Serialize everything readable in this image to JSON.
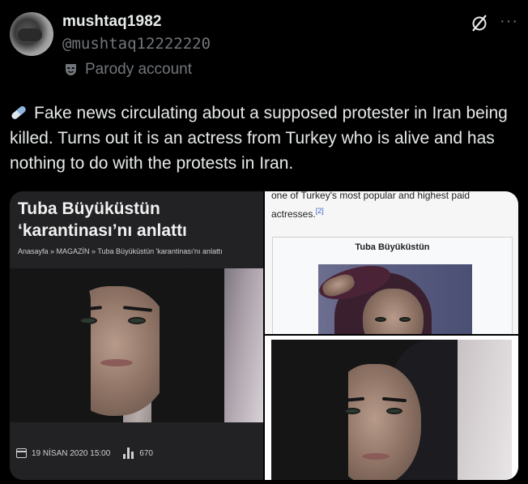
{
  "author": {
    "name": "mushtaq1982",
    "handle": "@mushtaq12222220",
    "label": "Parody account",
    "label_icon": "mask-icon"
  },
  "actions": {
    "grok_icon": "grok-icon",
    "more_icon": "more-icon",
    "more_glyph": "···"
  },
  "tweet": {
    "emoji": "pill-emoji",
    "text": "Fake news circulating about a supposed protester in Iran being killed. Turns out it is an actress from Turkey who is alive and has nothing to do with the protests in Iran."
  },
  "media": {
    "left": {
      "title": "Tuba Büyüküstün ‘karantinası’nı anlattı",
      "breadcrumb": "Anasayfa » MAGAZİN » Tuba Büyüküstün 'karantinası'nı anlattı",
      "date": "19 NİSAN 2020 15:00",
      "views": "670"
    },
    "right_top": {
      "text": "one of Turkey's most popular and highest paid actresses.",
      "ref": "[2]",
      "infobox_title": "Tuba Büyüküstün"
    }
  },
  "colors": {
    "background": "#000000",
    "text": "#e7e9ea",
    "muted": "#71767b",
    "link": "#3366cc"
  }
}
